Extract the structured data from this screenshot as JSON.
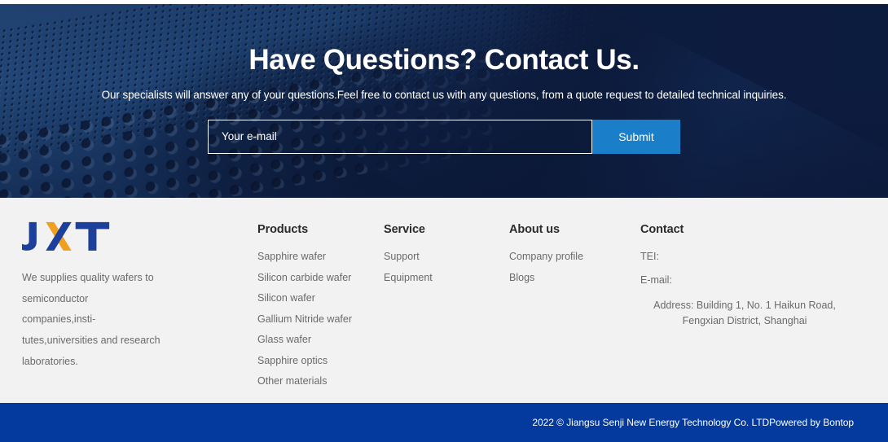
{
  "hero": {
    "title": "Have Questions? Contact Us.",
    "subtitle": "Our specialists will answer any of your questions.Feel free to contact us with any questions, from a quote request to detailed technical inquiries.",
    "email_placeholder": "Your e-mail",
    "email_value": "",
    "submit_label": "Submit"
  },
  "footer": {
    "logo_text": "JXT",
    "description": "We supplies quality wafers to semiconductor companies,insti-tutes,universities and research laboratories.",
    "columns": [
      {
        "heading": "Products",
        "items": [
          "Sapphire wafer",
          "Silicon carbide wafer",
          "Silicon wafer",
          "Gallium Nitride wafer",
          "Glass wafer",
          "Sapphire optics",
          "Other materials"
        ]
      },
      {
        "heading": "Service",
        "items": [
          "Support",
          "Equipment"
        ]
      },
      {
        "heading": "About us",
        "items": [
          "Company profile",
          "Blogs"
        ]
      }
    ],
    "contact": {
      "heading": "Contact",
      "tel_label": "TEI:",
      "email_label": "E-mail:",
      "address": "Address: Building 1, No. 1 Haikun Road, Fengxian District, Shanghai"
    }
  },
  "bottom_bar": {
    "copyright": "2022 © Jiangsu Senji New Energy Technology Co. LTDPowered by Bontop"
  },
  "colors": {
    "brand_blue": "#1c3f9c",
    "brand_orange": "#f0a020",
    "submit_blue": "#1a7fc8",
    "bottom_bar_blue": "#043a9e",
    "footer_bg": "#f2f2f2",
    "body_text": "#6a6a6a",
    "heading_text": "#2b2b2b"
  }
}
